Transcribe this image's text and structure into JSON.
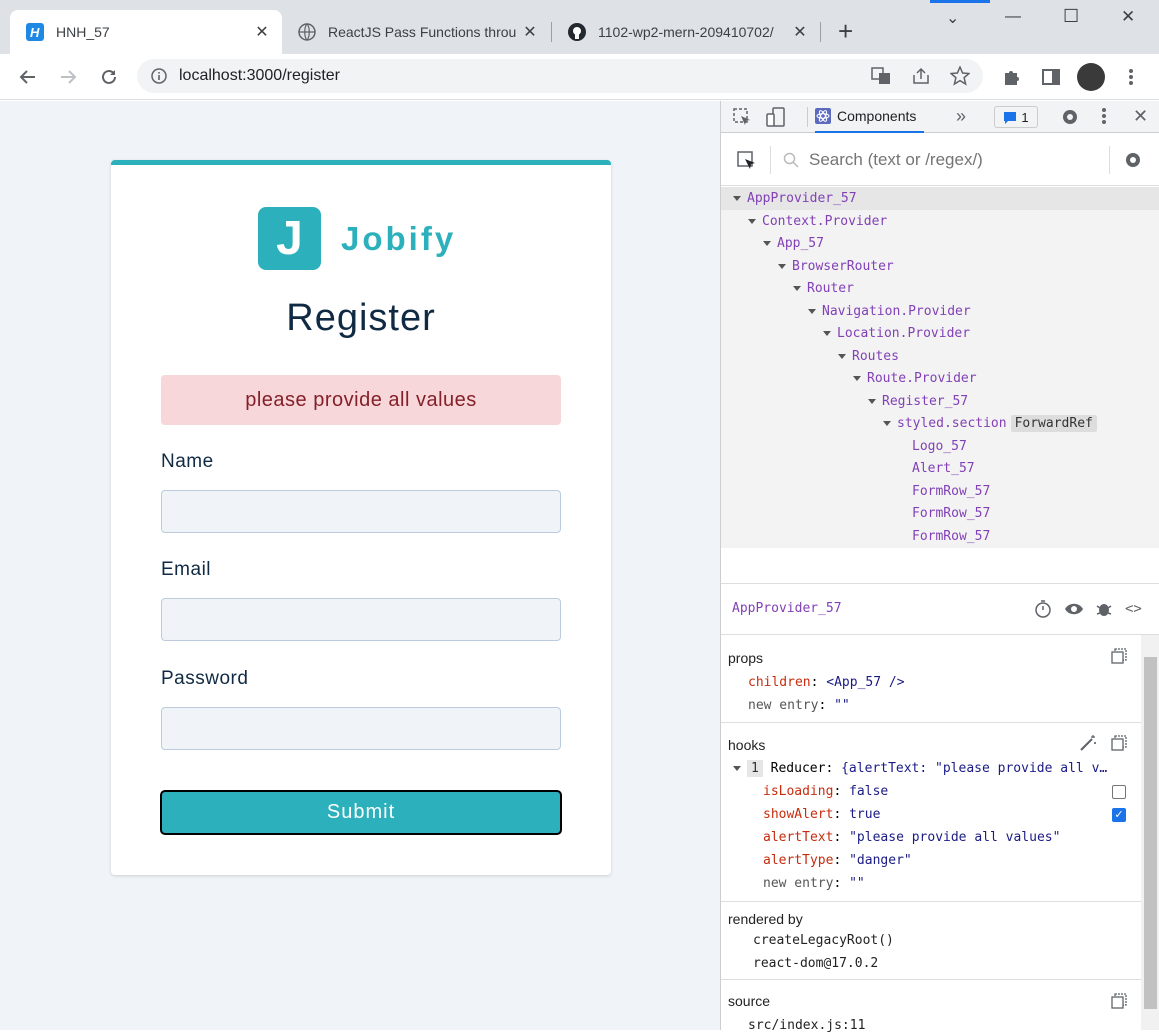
{
  "browser": {
    "tabs": [
      {
        "title": "HNH_57",
        "active": true
      },
      {
        "title": "ReactJS Pass Functions throu",
        "active": false
      },
      {
        "title": "1102-wp2-mern-209410702/",
        "active": false
      }
    ],
    "new_tab": "+",
    "url": "localhost:3000/register",
    "window_controls": [
      "⌄",
      "—",
      "☐",
      "✕"
    ]
  },
  "page": {
    "logo_letter": "J",
    "logo_text": "Jobify",
    "title": "Register",
    "alert": "please provide all values",
    "fields": [
      {
        "label": "Name",
        "value": ""
      },
      {
        "label": "Email",
        "value": ""
      },
      {
        "label": "Password",
        "value": ""
      }
    ],
    "submit": "Submit"
  },
  "devtools": {
    "tab": "Components",
    "more": "»",
    "issues_count": "1",
    "search_placeholder": "Search (text or /regex/)",
    "tree": [
      {
        "label": "AppProvider_57",
        "depth": 0,
        "expanded": true,
        "selected": true
      },
      {
        "label": "Context.Provider",
        "depth": 1,
        "expanded": true
      },
      {
        "label": "App_57",
        "depth": 2,
        "expanded": true
      },
      {
        "label": "BrowserRouter",
        "depth": 3,
        "expanded": true
      },
      {
        "label": "Router",
        "depth": 4,
        "expanded": true
      },
      {
        "label": "Navigation.Provider",
        "depth": 5,
        "expanded": true
      },
      {
        "label": "Location.Provider",
        "depth": 6,
        "expanded": true
      },
      {
        "label": "Routes",
        "depth": 7,
        "expanded": true
      },
      {
        "label": "Route.Provider",
        "depth": 8,
        "expanded": true
      },
      {
        "label": "Register_57",
        "depth": 9,
        "expanded": true
      },
      {
        "label": "styled.section",
        "depth": 10,
        "expanded": true,
        "badge": "ForwardRef"
      },
      {
        "label": "Logo_57",
        "depth": 11,
        "expanded": false
      },
      {
        "label": "Alert_57",
        "depth": 11,
        "expanded": false
      },
      {
        "label": "FormRow_57",
        "depth": 11,
        "expanded": false
      },
      {
        "label": "FormRow_57",
        "depth": 11,
        "expanded": false
      },
      {
        "label": "FormRow_57",
        "depth": 11,
        "expanded": false
      }
    ],
    "selected": "AppProvider_57",
    "props": {
      "heading": "props",
      "children_key": "children",
      "children_val": "<App_57 />",
      "new_entry_key": "new entry",
      "new_entry_val": "\"\""
    },
    "hooks": {
      "heading": "hooks",
      "index": "1",
      "reducer_label": "Reducer:",
      "reducer_val": "{alertText: \"please provide all v…",
      "rows": [
        {
          "key": "isLoading",
          "val": "false",
          "checkbox": false
        },
        {
          "key": "showAlert",
          "val": "true",
          "checkbox": true
        },
        {
          "key": "alertText",
          "val": "\"please provide all values\""
        },
        {
          "key": "alertType",
          "val": "\"danger\""
        }
      ],
      "new_entry_key": "new entry",
      "new_entry_val": "\"\""
    },
    "rendered_by": {
      "heading": "rendered by",
      "items": [
        "createLegacyRoot()",
        "react-dom@17.0.2"
      ]
    },
    "source": {
      "heading": "source",
      "value": "src/index.js:11"
    }
  }
}
